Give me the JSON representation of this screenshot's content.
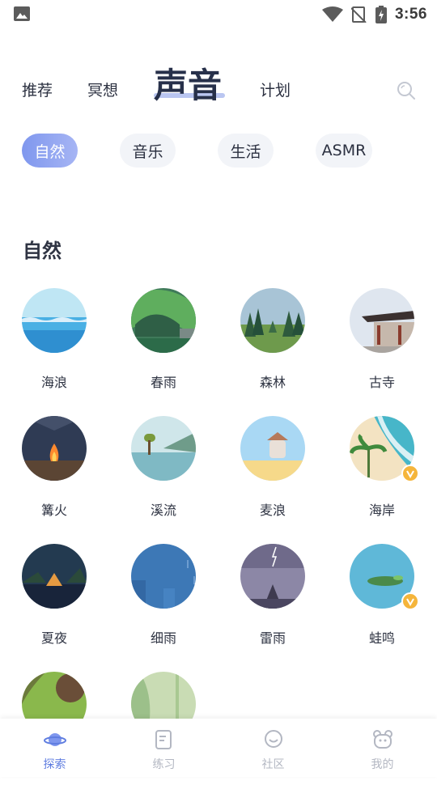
{
  "status_bar": {
    "time": "3:56"
  },
  "top_tabs": [
    {
      "label": "推荐"
    },
    {
      "label": "冥想"
    },
    {
      "label": "声音"
    },
    {
      "label": "计划"
    }
  ],
  "chips": [
    {
      "label": "自然"
    },
    {
      "label": "音乐"
    },
    {
      "label": "生活"
    },
    {
      "label": "ASMR"
    }
  ],
  "section": {
    "title": "自然"
  },
  "sounds": [
    {
      "label": "海浪"
    },
    {
      "label": "春雨"
    },
    {
      "label": "森林"
    },
    {
      "label": "古寺"
    },
    {
      "label": "篝火"
    },
    {
      "label": "溪流"
    },
    {
      "label": "麦浪"
    },
    {
      "label": "海岸"
    },
    {
      "label": "夏夜"
    },
    {
      "label": "细雨"
    },
    {
      "label": "雷雨"
    },
    {
      "label": "蛙鸣"
    }
  ],
  "bottom_nav": [
    {
      "label": "探索"
    },
    {
      "label": "练习"
    },
    {
      "label": "社区"
    },
    {
      "label": "我的"
    }
  ],
  "colors": {
    "accent": "#5f7de0",
    "chip_active": "#8ea2f0",
    "inactive": "#b3b7c2"
  }
}
